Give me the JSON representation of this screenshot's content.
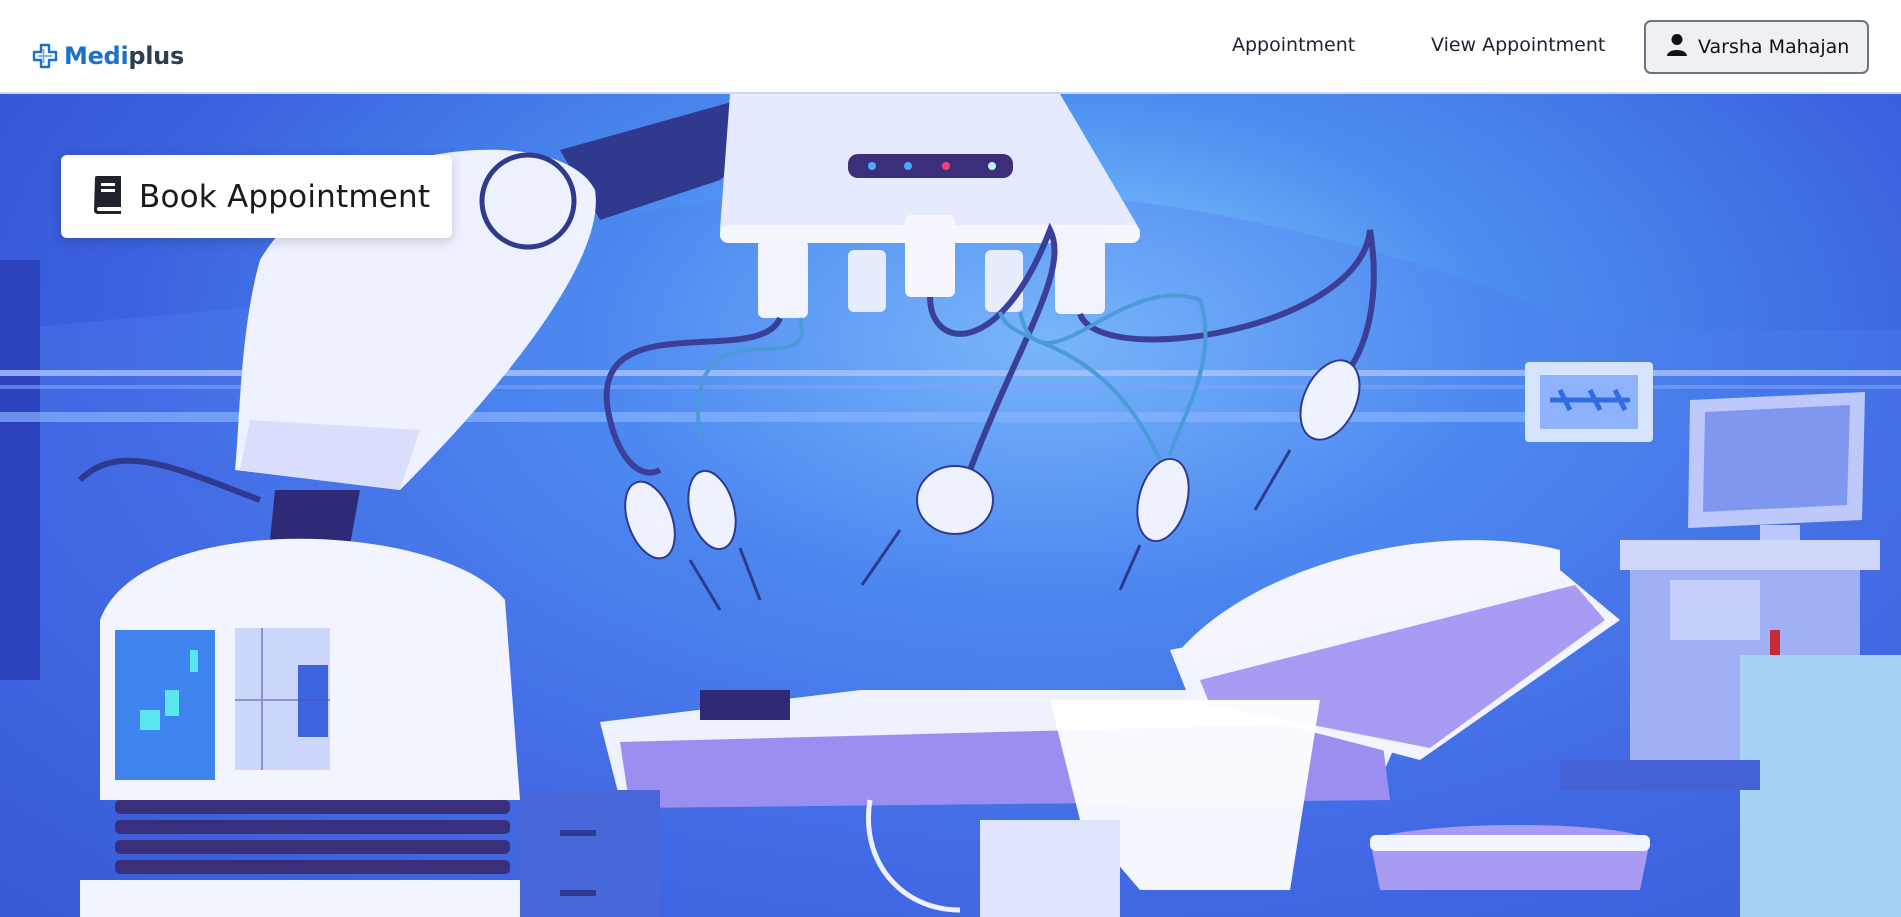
{
  "brand": {
    "part1": "Medi",
    "part2": "plus",
    "icon": "medical-cross-icon",
    "colors": {
      "medi": "#1a73c8",
      "plus": "#2c3e50"
    }
  },
  "nav": {
    "appointment": "Appointment",
    "view_appointment": "View Appointment"
  },
  "user": {
    "name": "Varsha Mahajan",
    "icon": "user-icon"
  },
  "hero": {
    "book_button_label": "Book Appointment",
    "book_icon": "book-icon",
    "illustration": "robotic-surgery-illustration"
  },
  "colors": {
    "hero_blue": "#3c62df",
    "accent": "#1a73c8"
  }
}
